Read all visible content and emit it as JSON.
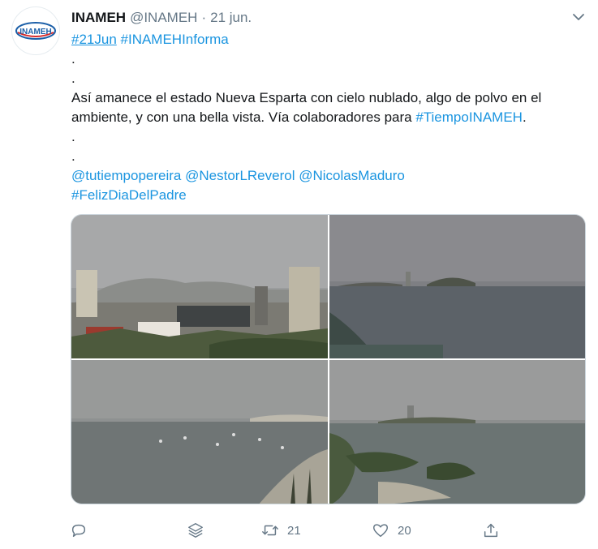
{
  "tweet": {
    "display_name": "INAMEH",
    "handle": "@INAMEH",
    "separator": "·",
    "date": "21 jun.",
    "avatar_logo_text": "INAMEH",
    "lines": {
      "hashtag_date": "#21Jun",
      "hashtag_informa": "#INAMEHInforma",
      "dot1": ".",
      "dot2": ".",
      "text_part1": "Así amanece el estado Nueva Esparta con cielo nublado, algo de polvo en el ambiente, y con una bella vista. Vía colaboradores para ",
      "hashtag_tiempo": "#TiempoINAMEH",
      "text_part2": ".",
      "dot3": ".",
      "dot4": ".",
      "mention1": "@tutiempopereira",
      "mention2": "@NestorLReverol",
      "mention3": "@NicolasMaduro",
      "hashtag_padre": "#FelizDiaDelPadre"
    }
  },
  "actions": {
    "reply_icon": "reply-icon",
    "stack_icon": "stack-icon",
    "retweet_icon": "retweet-icon",
    "retweet_count": "21",
    "like_icon": "heart-icon",
    "like_count": "20",
    "share_icon": "share-icon"
  },
  "colors": {
    "link": "#1b95e0",
    "muted": "#657786",
    "text": "#14171a"
  }
}
